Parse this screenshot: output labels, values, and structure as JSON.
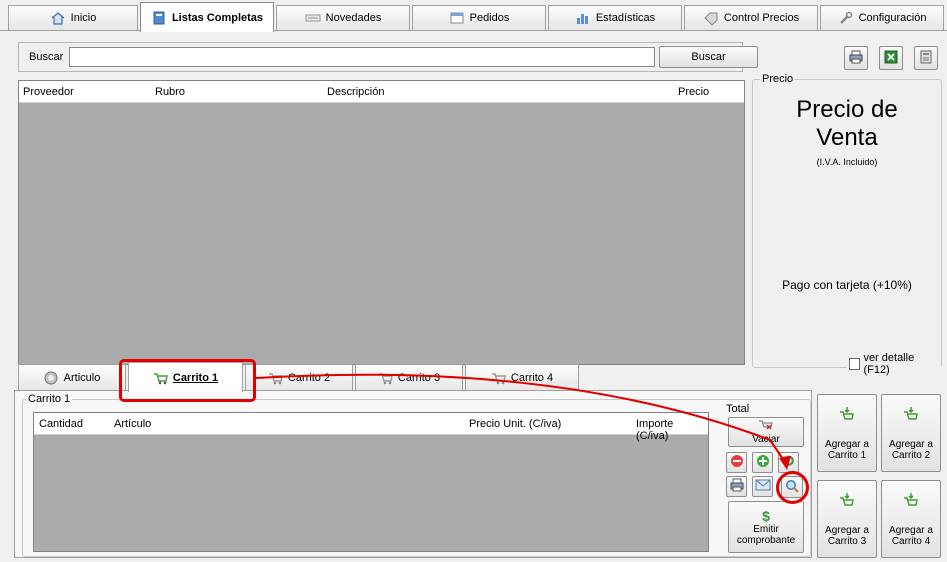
{
  "top_tabs": [
    {
      "label": "Inicio",
      "icon": "home-icon"
    },
    {
      "label": "Listas Completas",
      "icon": "book-icon"
    },
    {
      "label": "Novedades",
      "icon": "news-icon"
    },
    {
      "label": "Pedidos",
      "icon": "document-icon"
    },
    {
      "label": "Estadísticas",
      "icon": "bar-chart-icon"
    },
    {
      "label": "Control Precios",
      "icon": "tag-icon"
    },
    {
      "label": "Configuración",
      "icon": "wrench-icon"
    }
  ],
  "search": {
    "label": "Buscar",
    "value": "",
    "button_label": "Buscar"
  },
  "toolbar_icons": [
    "printer-icon",
    "excel-icon",
    "calculator-icon"
  ],
  "product_grid": {
    "columns": [
      "Proveedor",
      "Rubro",
      "Descripción",
      "Precio"
    ],
    "rows": []
  },
  "price_panel": {
    "group_label": "Precio",
    "title_line1": "Precio de",
    "title_line2": "Venta",
    "vat_note": "(I.V.A. Incluido)",
    "card_note": "Pago con tarjeta (+10%)",
    "detail_checkbox_label": "ver detalle (F12)",
    "detail_checked": false
  },
  "bottom_tabs": [
    {
      "label": "Articulo",
      "icon": "info-icon"
    },
    {
      "label": "Carrito 1",
      "icon": "cart-icon"
    },
    {
      "label": "Carrito 2",
      "icon": "cart-icon"
    },
    {
      "label": "Carrito 3",
      "icon": "cart-icon"
    },
    {
      "label": "Carrito 4",
      "icon": "cart-icon"
    }
  ],
  "cart": {
    "group_label": "Carrito 1",
    "columns": [
      "Cantidad",
      "Artículo",
      "Precio Unit. (C/iva)",
      "Importe (C/iva)"
    ],
    "rows": []
  },
  "total": {
    "label": "Total",
    "empty_label": "Vaciar",
    "emit_label_line1": "Emitir",
    "emit_label_line2": "comprobante",
    "action_icons": [
      "remove-icon",
      "add-icon",
      "refresh-icon",
      "printer-icon",
      "email-icon",
      "search-icon"
    ]
  },
  "add_buttons": [
    {
      "line1": "Agregar a",
      "line2": "Carrito 1"
    },
    {
      "line1": "Agregar a",
      "line2": "Carrito 2"
    },
    {
      "line1": "Agregar a",
      "line2": "Carrito 3"
    },
    {
      "line1": "Agregar a",
      "line2": "Carrito 4"
    }
  ],
  "colors": {
    "highlight": "#e00000",
    "grid_background": "#ababab",
    "window_background": "#f0f0f0"
  }
}
